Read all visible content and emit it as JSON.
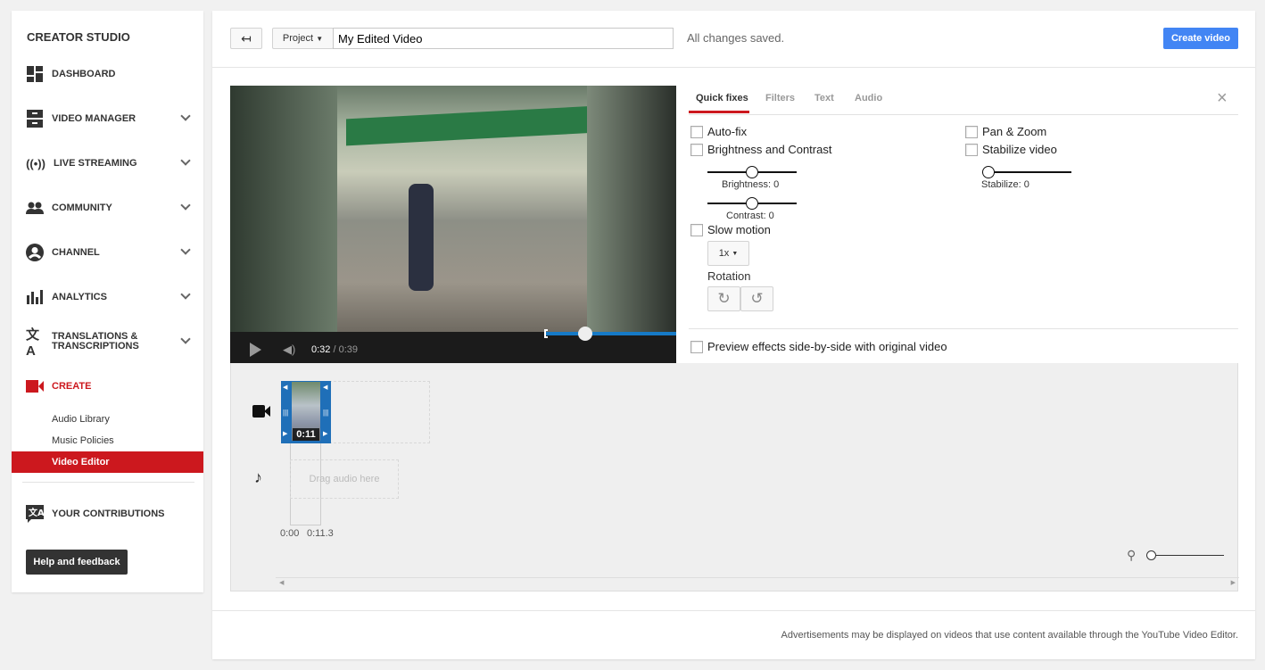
{
  "sidebar": {
    "brand": "CREATOR STUDIO",
    "items": [
      {
        "label": "DASHBOARD",
        "icon": "dashboard-icon"
      },
      {
        "label": "VIDEO MANAGER",
        "icon": "video-manager-icon"
      },
      {
        "label": "LIVE STREAMING",
        "icon": "live-streaming-icon"
      },
      {
        "label": "COMMUNITY",
        "icon": "community-icon"
      },
      {
        "label": "CHANNEL",
        "icon": "channel-icon"
      },
      {
        "label": "ANALYTICS",
        "icon": "analytics-icon"
      },
      {
        "label1": "TRANSLATIONS &",
        "label2": "TRANSCRIPTIONS",
        "icon": "translate-icon"
      },
      {
        "label": "CREATE",
        "icon": "video-camera-icon"
      }
    ],
    "create_sub": [
      "Audio Library",
      "Music Policies",
      "Video Editor"
    ],
    "contributions": "YOUR CONTRIBUTIONS",
    "help": "Help and feedback"
  },
  "header": {
    "project_label": "Project",
    "title_value": "My Edited Video",
    "status": "All changes saved.",
    "create_label": "Create video"
  },
  "player": {
    "current": "0:32",
    "total": "/ 0:39",
    "progress": 0.82
  },
  "panel": {
    "tabs": [
      "Quick fixes",
      "Filters",
      "Text",
      "Audio"
    ],
    "autofix": "Auto-fix",
    "brightness_contrast": "Brightness and Contrast",
    "brightness": "Brightness: 0",
    "contrast": "Contrast: 0",
    "slow_motion": "Slow motion",
    "speed": "1x",
    "rotation": "Rotation",
    "pan_zoom": "Pan & Zoom",
    "stabilize_video": "Stabilize video",
    "stabilize": "Stabilize: 0",
    "preview": "Preview effects side-by-side with original video"
  },
  "timeline": {
    "clip_duration": "0:11",
    "drag_audio": "Drag audio here",
    "t0": "0:00",
    "t1": "0:11.3"
  },
  "footer": "Advertisements may be displayed on videos that use content available through the YouTube Video Editor.",
  "colors": {
    "accent": "#cc181e",
    "blue": "#4285f4"
  }
}
